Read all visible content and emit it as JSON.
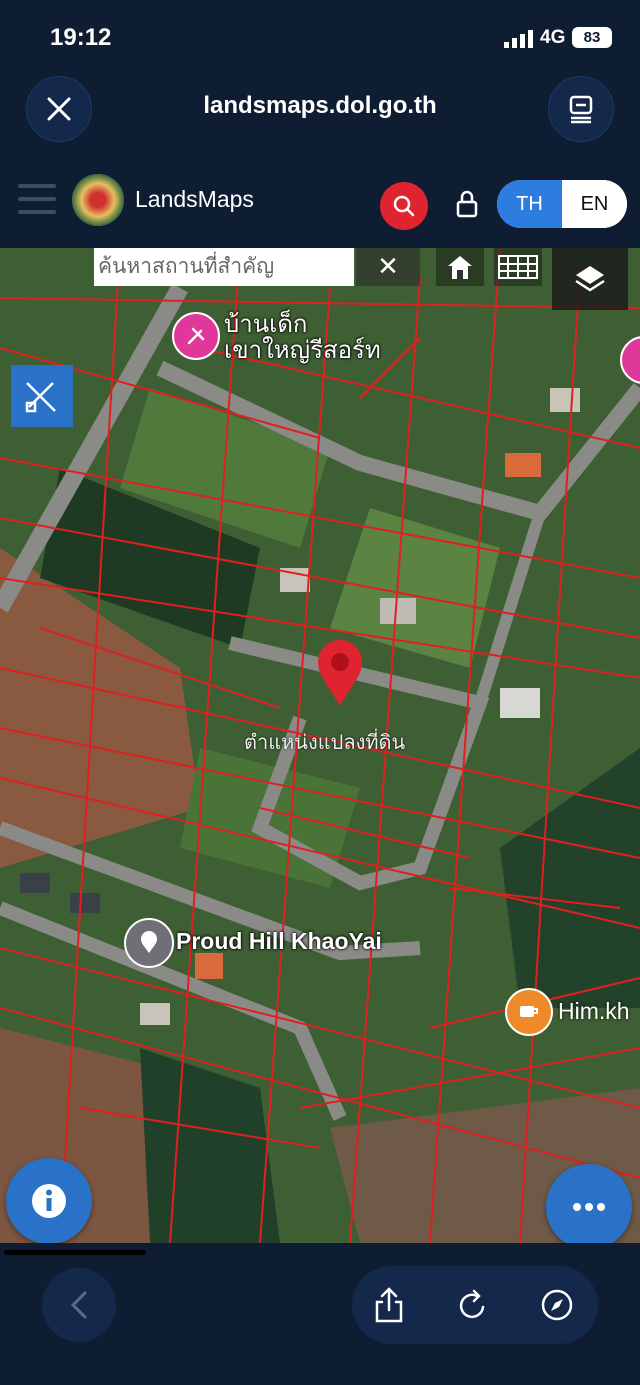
{
  "status": {
    "time": "19:12",
    "network": "4G",
    "battery": "83"
  },
  "browser": {
    "url": "landsmaps.dol.go.th"
  },
  "header": {
    "brand": "LandsMaps",
    "lang_th": "TH",
    "lang_en": "EN"
  },
  "map": {
    "search_placeholder": "ค้นหาสถานที่สำคัญ",
    "clear_label": "✕",
    "poi_resort": "บ้านเด็ก\nเขาใหญ่รีสอร์ท",
    "marker_label": "ตำแหน่งแปลงที่ดิน",
    "poi_proud_hill": "Proud Hill KhaoYai",
    "poi_cafe": "Him.kh"
  },
  "colors": {
    "accent_blue": "#2a72c8",
    "search_red": "#e0242f",
    "parcel_line": "#e02020",
    "background": "#0f1d33"
  }
}
